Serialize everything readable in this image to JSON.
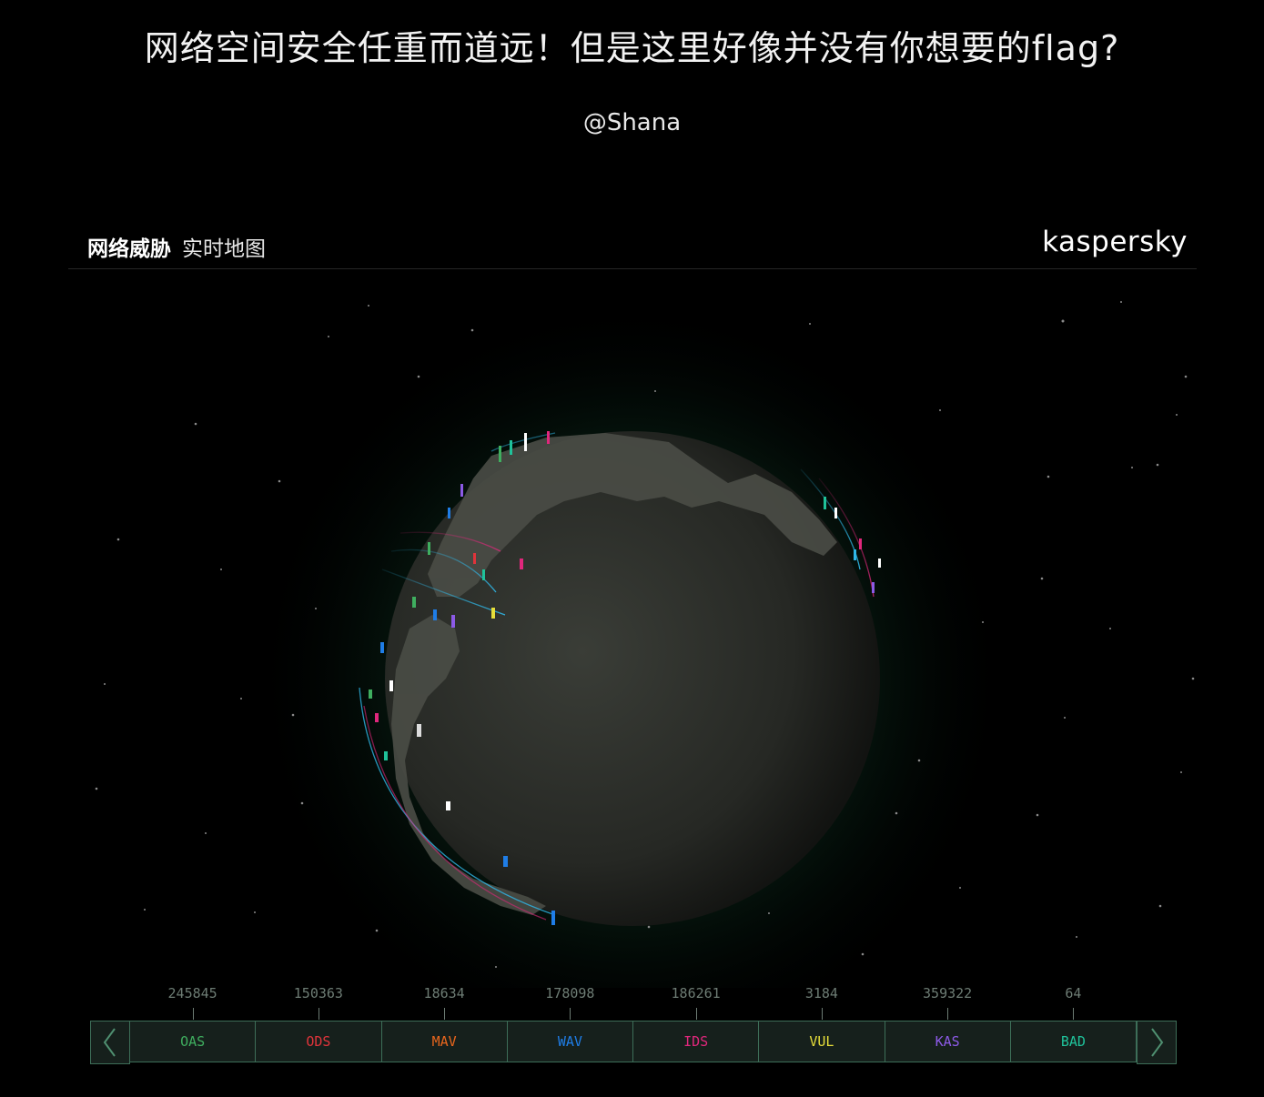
{
  "headline": "网络空间安全任重而道远！但是这里好像并没有你想要的flag?",
  "author": "@Shana",
  "map_header": {
    "title_strong": "网络威胁",
    "title_light": "实时地图",
    "brand": "kaspersky"
  },
  "colors": {
    "background": "#000000",
    "tab_border": "#3d6e58",
    "tab_fill": "#16201c",
    "count_text": "#6d7c74",
    "globe_glow": "#1f6b45"
  },
  "stats": {
    "prev_icon": "chevron-left-icon",
    "next_icon": "chevron-right-icon",
    "tabs": [
      {
        "label": "OAS",
        "count": "245845",
        "color": "#3fae5f"
      },
      {
        "label": "ODS",
        "count": "150363",
        "color": "#e0343b"
      },
      {
        "label": "MAV",
        "count": "18634",
        "color": "#e8661d"
      },
      {
        "label": "WAV",
        "count": "178098",
        "color": "#1f7de6"
      },
      {
        "label": "IDS",
        "count": "186261",
        "color": "#e0277c"
      },
      {
        "label": "VUL",
        "count": "3184",
        "color": "#e6de3a"
      },
      {
        "label": "KAS",
        "count": "359322",
        "color": "#8c5ae6"
      },
      {
        "label": "BAD",
        "count": "64",
        "color": "#1fc29a"
      }
    ]
  }
}
